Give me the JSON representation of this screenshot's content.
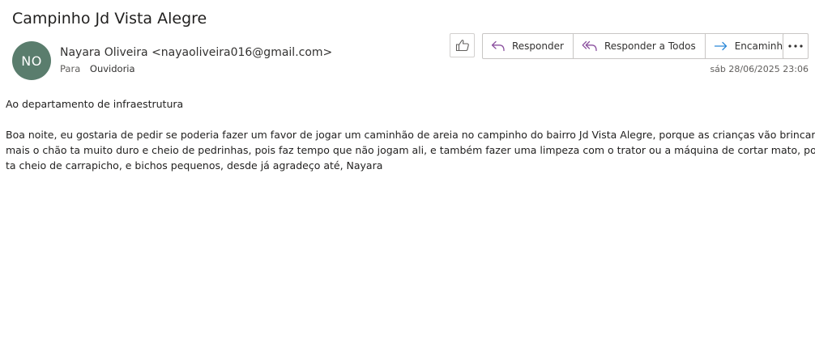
{
  "email": {
    "subject": "Campinho Jd Vista Alegre",
    "avatar_initials": "NO",
    "avatar_color": "#5a7d6d",
    "sender": "Nayara Oliveira <nayaoliveira016@gmail.com>",
    "to_label": "Para",
    "to_value": "Ouvidoria",
    "date": "sáb 28/06/2025 23:06",
    "greeting": "Ao departamento de infraestrutura",
    "body_lines": [
      "Boa  noite,  eu gostaria de pedir se poderia fazer um favor de jogar um caminhão de areia no campinho do bairro Jd Vista Alegre,  porque as crianças vão brincar lá",
      "mais o chão ta muito duro e cheio de pedrinhas, pois faz tempo que não jogam ali, e também fazer uma limpeza com o trator ou  a máquina de cortar mato, porque",
      "ta cheio de carrapicho, e bichos pequenos, desde já agradeço até,  Nayara"
    ]
  },
  "actions": {
    "like_icon": "thumbs-up-icon",
    "reply_label": "Responder",
    "reply_icon": "reply-icon",
    "reply_all_label": "Responder a Todos",
    "reply_all_icon": "reply-all-icon",
    "forward_label": "Encaminhar",
    "forward_icon": "forward-icon",
    "more_icon": "more-options-icon",
    "reply_color": "#8a4f9e",
    "forward_color": "#2b88d8"
  }
}
